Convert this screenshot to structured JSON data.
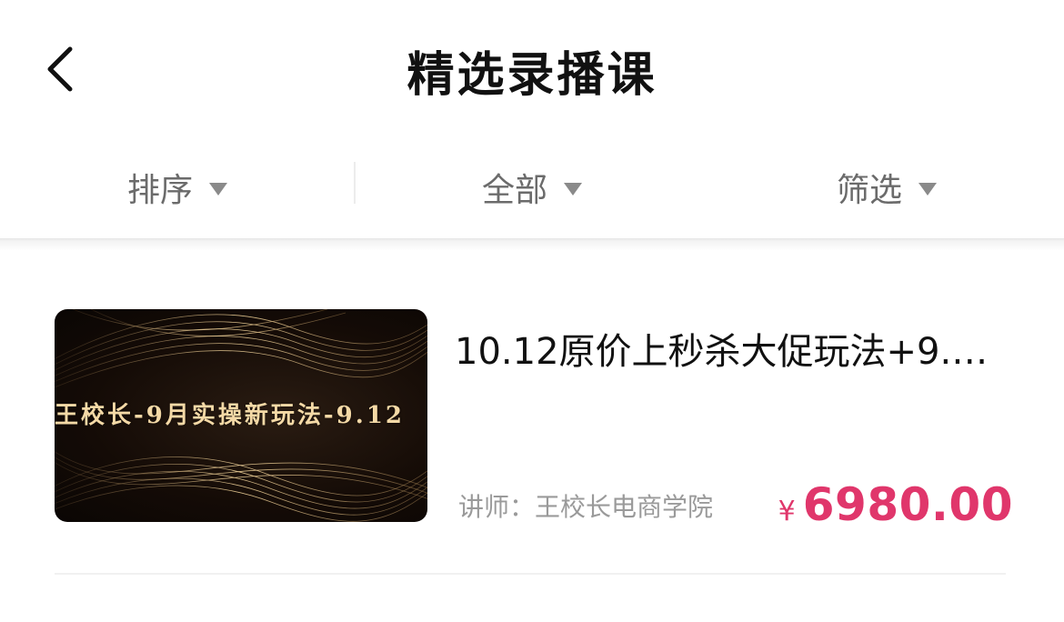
{
  "header": {
    "title": "精选录播课",
    "back_icon": "chevron-left-icon"
  },
  "filters": [
    {
      "label": "排序",
      "icon": "caret-down-icon"
    },
    {
      "label": "全部",
      "icon": "caret-down-icon"
    },
    {
      "label": "筛选",
      "icon": "caret-down-icon"
    }
  ],
  "course": {
    "cover_text": "王校长-9月实操新玩法-9.12",
    "title": "10.12原价上秒杀大促玩法+9.…",
    "lecturer": "讲师：王校长电商学院",
    "currency": "¥",
    "price": "6980.00"
  },
  "colors": {
    "price": "#e0366b",
    "title": "#111111",
    "muted": "#9a9a9a",
    "filter_text": "#6b6b6b",
    "cover_bg": "#140b06",
    "cover_gold": "#f4d9a6"
  }
}
